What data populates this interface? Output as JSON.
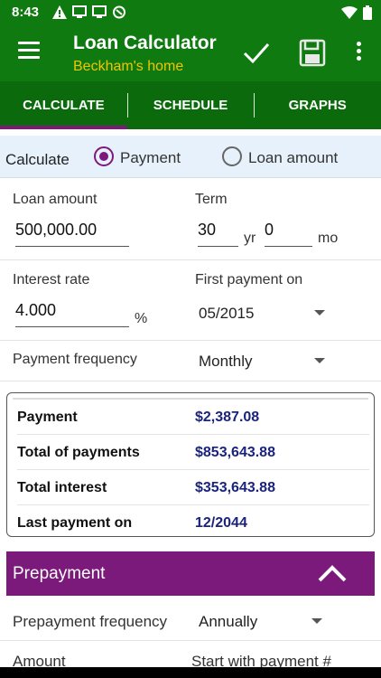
{
  "status_bar": {
    "time": "8:43"
  },
  "app_bar": {
    "title": "Loan Calculator",
    "subtitle": "Beckham's home"
  },
  "tabs": [
    {
      "label": "CALCULATE"
    },
    {
      "label": "SCHEDULE"
    },
    {
      "label": "GRAPHS"
    }
  ],
  "calculate": {
    "label": "Calculate",
    "options": [
      {
        "label": "Payment",
        "selected": true
      },
      {
        "label": "Loan amount",
        "selected": false
      }
    ]
  },
  "form": {
    "loan_amount": {
      "label": "Loan amount",
      "value": "500,000.00"
    },
    "term": {
      "label": "Term",
      "years": "30",
      "years_unit": "yr",
      "months": "0",
      "months_unit": "mo"
    },
    "interest_rate": {
      "label": "Interest rate",
      "value": "4.000",
      "unit": "%"
    },
    "first_payment": {
      "label": "First payment on",
      "value": "05/2015"
    },
    "payment_frequency": {
      "label": "Payment frequency",
      "value": "Monthly"
    }
  },
  "results": [
    {
      "label": "Payment",
      "value": "$2,387.08"
    },
    {
      "label": "Total of payments",
      "value": "$853,643.88"
    },
    {
      "label": "Total interest",
      "value": "$353,643.88"
    },
    {
      "label": "Last payment on",
      "value": "12/2044"
    }
  ],
  "prepayment": {
    "title": "Prepayment",
    "frequency_label": "Prepayment frequency",
    "frequency_value": "Annually",
    "amount_label": "Amount",
    "start_label": "Start with payment #"
  },
  "colors": {
    "primary_green": "#0f7a0f",
    "tab_green": "#0b6a0b",
    "accent_purple": "#7b1a7b",
    "subtitle_yellow": "#f2c400",
    "value_navy": "#1a237e"
  },
  "icons": [
    "menu-icon",
    "check-icon",
    "save-icon",
    "more-vert-icon",
    "chevron-up-icon",
    "dropdown-caret-icon",
    "wifi-icon",
    "battery-icon"
  ]
}
